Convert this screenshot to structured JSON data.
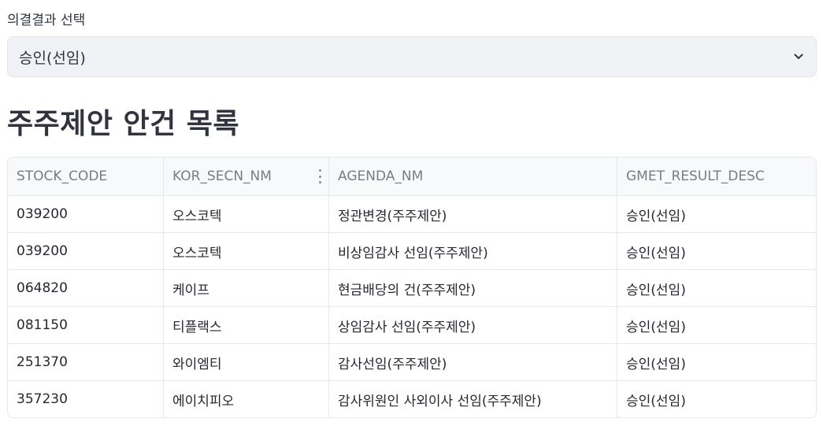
{
  "filter": {
    "label": "의결결과 선택",
    "selected": "승인(선임)",
    "icon": "chevron-down-icon"
  },
  "section": {
    "title": "주주제안 안건 목록"
  },
  "table": {
    "columns": [
      "STOCK_CODE",
      "KOR_SECN_NM",
      "AGENDA_NM",
      "GMET_RESULT_DESC"
    ],
    "rows": [
      [
        "039200",
        "오스코텍",
        "정관변경(주주제안)",
        "승인(선임)"
      ],
      [
        "039200",
        "오스코텍",
        "비상임감사 선임(주주제안)",
        "승인(선임)"
      ],
      [
        "064820",
        "케이프",
        "현금배당의 건(주주제안)",
        "승인(선임)"
      ],
      [
        "081150",
        "티플랙스",
        "상임감사 선임(주주제안)",
        "승인(선임)"
      ],
      [
        "251370",
        "와이엠티",
        "감사선임(주주제안)",
        "승인(선임)"
      ],
      [
        "357230",
        "에이치피오",
        "감사위원인 사외이사 선임(주주제안)",
        "승인(선임)"
      ]
    ]
  },
  "colors": {
    "text": "#31333f",
    "select_bg": "#f0f2f6",
    "header_bg": "#f8f9fb",
    "border": "#e6e8ec"
  }
}
